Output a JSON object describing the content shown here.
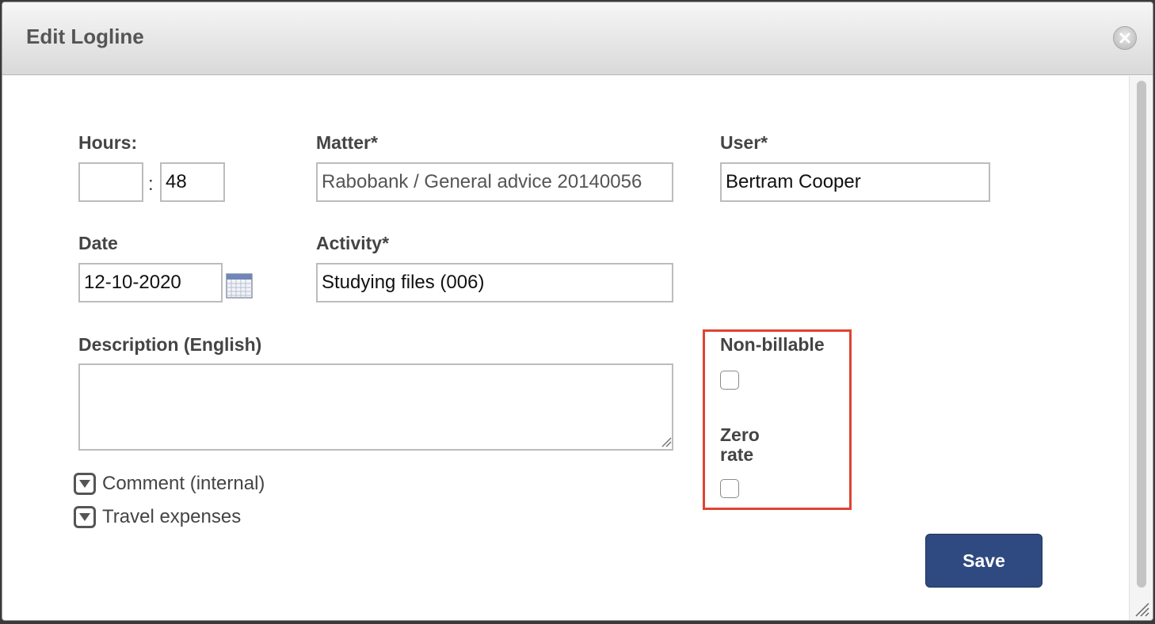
{
  "dialog": {
    "title": "Edit Logline",
    "close_icon": "close-icon"
  },
  "form": {
    "hours": {
      "label": "Hours:",
      "hours_value": "",
      "minutes_value": "48",
      "separator": ":"
    },
    "matter": {
      "label": "Matter*",
      "value": "Rabobank / General advice 20140056"
    },
    "user": {
      "label": "User*",
      "value": "Bertram Cooper"
    },
    "date": {
      "label": "Date",
      "value": "12-10-2020",
      "icon": "calendar-icon"
    },
    "activity": {
      "label": "Activity*",
      "value": "Studying files (006)"
    },
    "description": {
      "label": "Description (English)",
      "value": ""
    },
    "non_billable": {
      "label": "Non-billable",
      "checked": false
    },
    "zero_rate": {
      "label_line1": "Zero",
      "label_line2": "rate",
      "checked": false
    },
    "expanders": [
      {
        "label": "Comment (internal)",
        "icon": "expand-down-icon"
      },
      {
        "label": "Travel expenses",
        "icon": "expand-down-icon"
      }
    ],
    "save_label": "Save"
  },
  "colors": {
    "save_button": "#2e4a80",
    "highlight_border": "#e04430",
    "title_text": "#555555"
  }
}
